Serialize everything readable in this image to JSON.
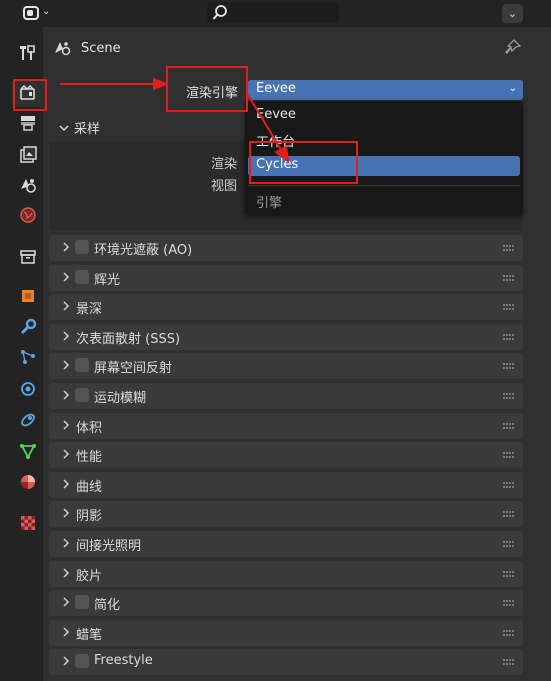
{
  "header": {
    "search_placeholder": ""
  },
  "tabs": [
    {
      "name": "tool-icon",
      "color": "#d9d9d9"
    },
    {
      "name": "render-icon",
      "color": "#d9d9d9",
      "active": true
    },
    {
      "name": "output-icon",
      "color": "#d9d9d9"
    },
    {
      "name": "view-layer-icon",
      "color": "#d9d9d9"
    },
    {
      "name": "scene-icon",
      "color": "#d9d9d9"
    },
    {
      "name": "world-icon",
      "color": "#e05a4d"
    },
    {
      "name": "collection-icon",
      "color": "#d9d9d9"
    },
    {
      "name": "object-icon",
      "color": "#e8822e"
    },
    {
      "name": "modifier-icon",
      "color": "#5aa6e8"
    },
    {
      "name": "particles-icon",
      "color": "#5aa6e8"
    },
    {
      "name": "physics-icon",
      "color": "#5aa6e8"
    },
    {
      "name": "constraints-icon",
      "color": "#5aa6e8"
    },
    {
      "name": "data-icon",
      "color": "#5ad05a"
    },
    {
      "name": "material-icon",
      "color": "#e05a4d"
    },
    {
      "name": "texture-icon",
      "color": "#d14b4b"
    }
  ],
  "scene": {
    "title": "Scene"
  },
  "render": {
    "engine_label": "渲染引擎",
    "engine_value": "Eevee",
    "engine_options": [
      "Eevee",
      "工作台",
      "Cycles"
    ],
    "highlighted_option": "Cycles",
    "dropdown_title": "引擎"
  },
  "sampling": {
    "title": "采样",
    "render_label": "渲染",
    "viewport_label": "视图"
  },
  "panels": [
    {
      "label": "环境光遮蔽 (AO)",
      "checkbox": true
    },
    {
      "label": "辉光",
      "checkbox": true
    },
    {
      "label": "景深",
      "checkbox": false
    },
    {
      "label": "次表面散射 (SSS)",
      "checkbox": false
    },
    {
      "label": "屏幕空间反射",
      "checkbox": true
    },
    {
      "label": "运动模糊",
      "checkbox": true
    },
    {
      "label": "体积",
      "checkbox": false
    },
    {
      "label": "性能",
      "checkbox": false
    },
    {
      "label": "曲线",
      "checkbox": false
    },
    {
      "label": "阴影",
      "checkbox": false
    },
    {
      "label": "间接光照明",
      "checkbox": false
    },
    {
      "label": "胶片",
      "checkbox": false
    },
    {
      "label": "简化",
      "checkbox": true
    },
    {
      "label": "蜡笔",
      "checkbox": false
    },
    {
      "label": "Freestyle",
      "checkbox": true
    }
  ],
  "colors": {
    "accent": "#4772b3",
    "annotation": "#e01e1e",
    "background": "#303030"
  }
}
